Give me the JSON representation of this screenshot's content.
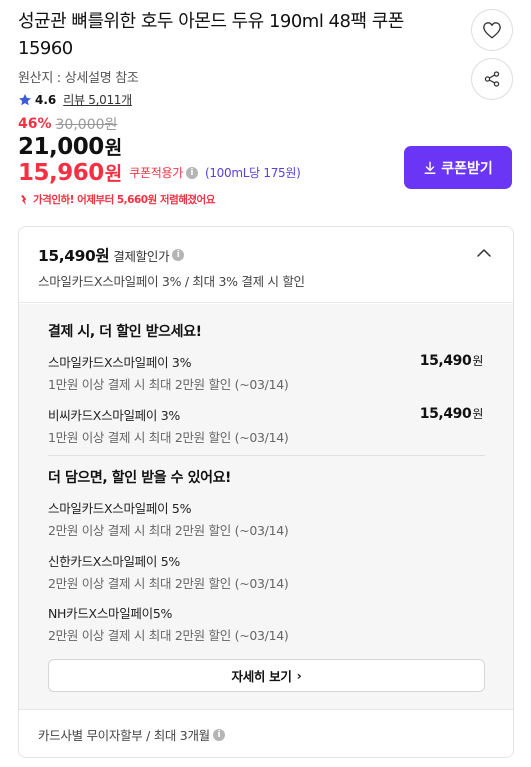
{
  "product": {
    "title": "성균관 뼈를위한 호두 아몬드 두유 190ml 48팩 쿠폰 15960",
    "origin": "원산지 : 상세설명 참조",
    "rating": "4.6",
    "reviews": "리뷰 5,011개"
  },
  "price": {
    "discount_pct": "46%",
    "original": "30,000원",
    "sale": "21,000",
    "sale_unit": "원",
    "coupon": "15,960",
    "coupon_unit": "원",
    "coupon_label": "쿠폰적용가",
    "unit_price": "(100mL당 175원)",
    "coupon_button": "쿠폰받기",
    "notice": "가격인하! 어제부터 5,660원 저렴해졌어요"
  },
  "payment": {
    "head_price": "15,490원",
    "head_label": "결제할인가",
    "head_sub": "스마일카드X스마일페이 3% / 최대 3% 결제 시 할인",
    "section1_title": "결제 시, 더 할인 받으세요!",
    "section1_items": [
      {
        "name": "스마일카드X스마일페이 3%",
        "desc": "1만원 이상 결제 시 최대 2만원 할인 (~03/14)",
        "price": "15,490",
        "unit": "원"
      },
      {
        "name": "비씨카드X스마일페이 3%",
        "desc": "1만원 이상 결제 시 최대 2만원 할인 (~03/14)",
        "price": "15,490",
        "unit": "원"
      }
    ],
    "section2_title": "더 담으면, 할인 받을 수 있어요!",
    "section2_items": [
      {
        "name": "스마일카드X스마일페이 5%",
        "desc": "2만원 이상 결제 시 최대 2만원 할인 (~03/14)"
      },
      {
        "name": "신한카드X스마일페이 5%",
        "desc": "2만원 이상 결제 시 최대 2만원 할인 (~03/14)"
      },
      {
        "name": "NH카드X스마일페이5%",
        "desc": "2만원 이상 결제 시 최대 2만원 할인 (~03/14)"
      }
    ],
    "detail_button": "자세히 보기",
    "detail_arrow": "›",
    "installment": "카드사별 무이자할부 / 최대 3개월"
  },
  "icons": {
    "wish": "heart-icon",
    "share": "share-icon",
    "rating": "star-icon",
    "info": "info-icon",
    "download": "download-icon",
    "notice": "price-drop-icon",
    "collapse": "chevron-up-icon"
  },
  "colors": {
    "accent_red": "#f43142",
    "coupon_button": "#6b35f5",
    "unit_price": "#5a3ee0",
    "star": "#3b5bdb"
  }
}
